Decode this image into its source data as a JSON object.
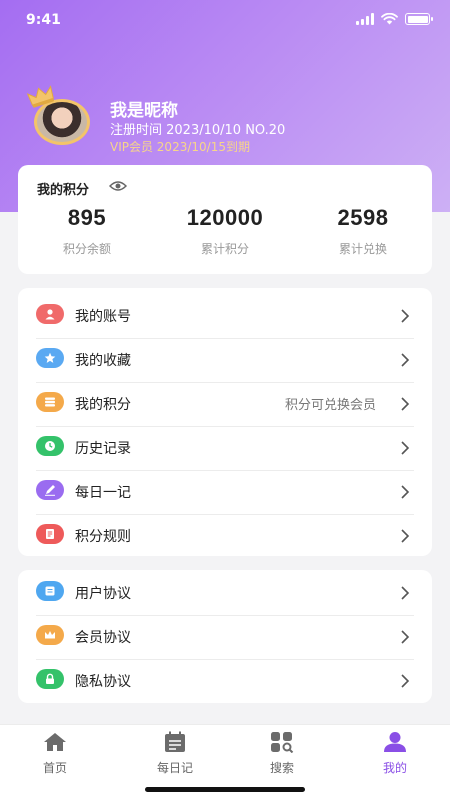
{
  "status_bar": {
    "time": "9:41"
  },
  "profile": {
    "nickname": "我是昵称",
    "register_line": "注册时间 2023/10/10 NO.20",
    "vip_line": "VIP会员 2023/10/15到期"
  },
  "points": {
    "title": "我的积分",
    "stats": [
      {
        "value": "895",
        "label": "积分余额"
      },
      {
        "value": "120000",
        "label": "累计积分"
      },
      {
        "value": "2598",
        "label": "累计兑换"
      }
    ]
  },
  "menu_group_1": [
    {
      "label": "我的账号",
      "icon": "user-icon",
      "color": "#f06a6a"
    },
    {
      "label": "我的收藏",
      "icon": "star-icon",
      "color": "#5aa9f2"
    },
    {
      "label": "我的积分",
      "icon": "coins-icon",
      "color": "#f4a94a",
      "hint": "积分可兑换会员"
    },
    {
      "label": "历史记录",
      "icon": "clock-icon",
      "color": "#34c26a"
    },
    {
      "label": "每日一记",
      "icon": "pen-icon",
      "color": "#9a6cf0"
    },
    {
      "label": "积分规则",
      "icon": "document-icon",
      "color": "#ee5a5a"
    }
  ],
  "menu_group_2": [
    {
      "label": "用户协议",
      "icon": "agreement-icon",
      "color": "#4fa7f0"
    },
    {
      "label": "会员协议",
      "icon": "crown-icon",
      "color": "#f4a94a"
    },
    {
      "label": "隐私协议",
      "icon": "lock-icon",
      "color": "#34c26a"
    }
  ],
  "tabbar": [
    {
      "label": "首页",
      "icon": "home-icon",
      "active": false
    },
    {
      "label": "每日记",
      "icon": "calendar-note-icon",
      "active": false
    },
    {
      "label": "搜索",
      "icon": "search-grid-icon",
      "active": false
    },
    {
      "label": "我的",
      "icon": "person-icon",
      "active": true
    }
  ],
  "colors": {
    "accent": "#8a4fe6",
    "header_gradient_start": "#a46df2",
    "header_gradient_end": "#cdb0f5",
    "vip_gold": "#f7d58a"
  }
}
